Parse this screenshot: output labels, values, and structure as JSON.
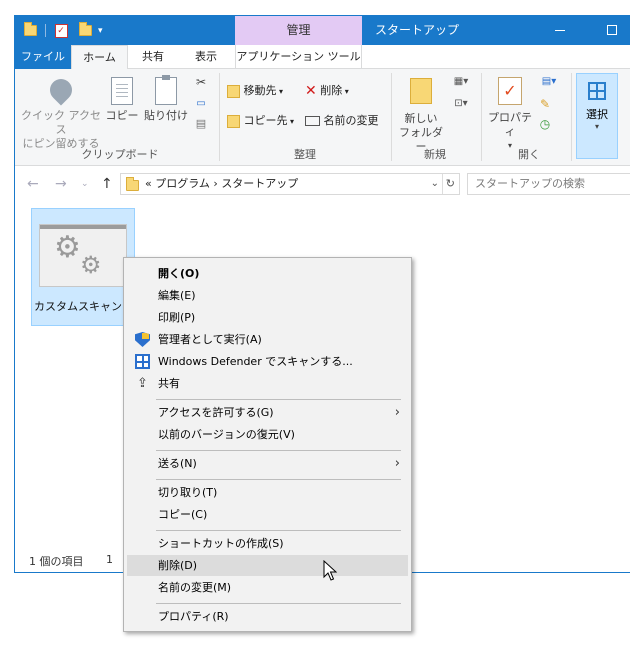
{
  "titlebar": {
    "manage_tab": "管理",
    "title": "スタートアップ"
  },
  "ribbon_tabs": {
    "file": "ファイル",
    "home": "ホーム",
    "share": "共有",
    "view": "表示",
    "app_tools": "アプリケーション ツール"
  },
  "ribbon": {
    "clipboard": {
      "quick_access": "クイック アクセス",
      "quick_access2": "にピン留めする",
      "copy": "コピー",
      "paste": "貼り付け",
      "label": "クリップボード"
    },
    "organize": {
      "move_to": "移動先",
      "copy_to": "コピー先",
      "delete": "削除",
      "rename": "名前の変更",
      "label": "整理"
    },
    "new": {
      "new_folder": "新しい",
      "new_folder2": "フォルダー",
      "label": "新規"
    },
    "open": {
      "properties": "プロパティ",
      "label": "開く"
    },
    "select": {
      "label": "選択"
    }
  },
  "addressbar": {
    "path_prefix": "«",
    "path_1": "プログラム",
    "path_sep": "›",
    "path_2": "スタートアップ",
    "search_placeholder": "スタートアップの検索"
  },
  "content": {
    "file_name": "カスタムスキャン.ba",
    "status_items": "1 個の項目",
    "status_selected": "1"
  },
  "context_menu": {
    "items": [
      {
        "label": "開く(O)"
      },
      {
        "label": "編集(E)"
      },
      {
        "label": "印刷(P)"
      },
      {
        "label": "管理者として実行(A)"
      },
      {
        "label": "Windows Defender でスキャンする..."
      },
      {
        "label": "共有"
      },
      {
        "label": "アクセスを許可する(G)"
      },
      {
        "label": "以前のバージョンの復元(V)"
      },
      {
        "label": "送る(N)"
      },
      {
        "label": "切り取り(T)"
      },
      {
        "label": "コピー(C)"
      },
      {
        "label": "ショートカットの作成(S)"
      },
      {
        "label": "削除(D)"
      },
      {
        "label": "名前の変更(M)"
      },
      {
        "label": "プロパティ(R)"
      }
    ],
    "highlight_color": "#dcdcdc"
  },
  "colors": {
    "accent": "#1979ca",
    "manage_tab": "#e3caf4",
    "selection": "#cce8ff"
  }
}
